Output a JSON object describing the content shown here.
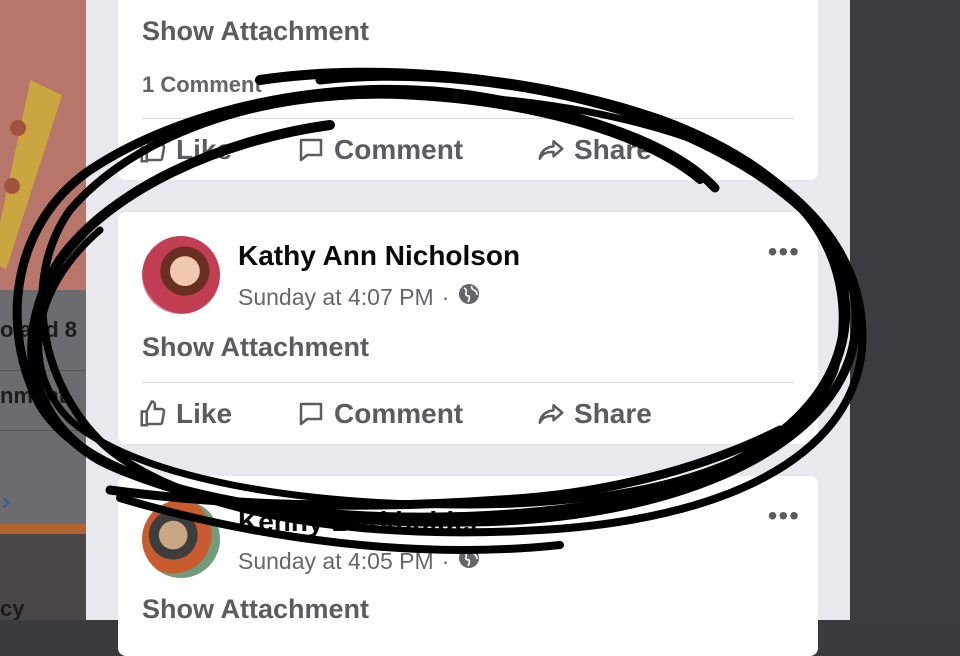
{
  "left_panel": {
    "fragment_1": "o and 8",
    "fragment_2": "nment",
    "fragment_3": "cy",
    "chevron": "›"
  },
  "posts": [
    {
      "attachment_label": "Show Attachment",
      "comment_count": "1 Comment",
      "actions": {
        "like": "Like",
        "comment": "Comment",
        "share": "Share"
      }
    },
    {
      "author": "Kathy Ann Nicholson",
      "time": "Sunday at 4:07 PM",
      "separator": "·",
      "privacy_icon": "globe-icon",
      "more": "•••",
      "attachment_label": "Show Attachment",
      "actions": {
        "like": "Like",
        "comment": "Comment",
        "share": "Share"
      }
    },
    {
      "author": "Kenny Burkholder",
      "time": "Sunday at 4:05 PM",
      "separator": "·",
      "privacy_icon": "globe-icon",
      "more": "•••",
      "attachment_label": "Show Attachment"
    }
  ],
  "colors": {
    "feed_bg": "#e9e8ee",
    "card_bg": "#ffffff",
    "secondary_text": "#5b5c62",
    "primary_text": "#0a0a0a",
    "scribble": "#000000"
  }
}
